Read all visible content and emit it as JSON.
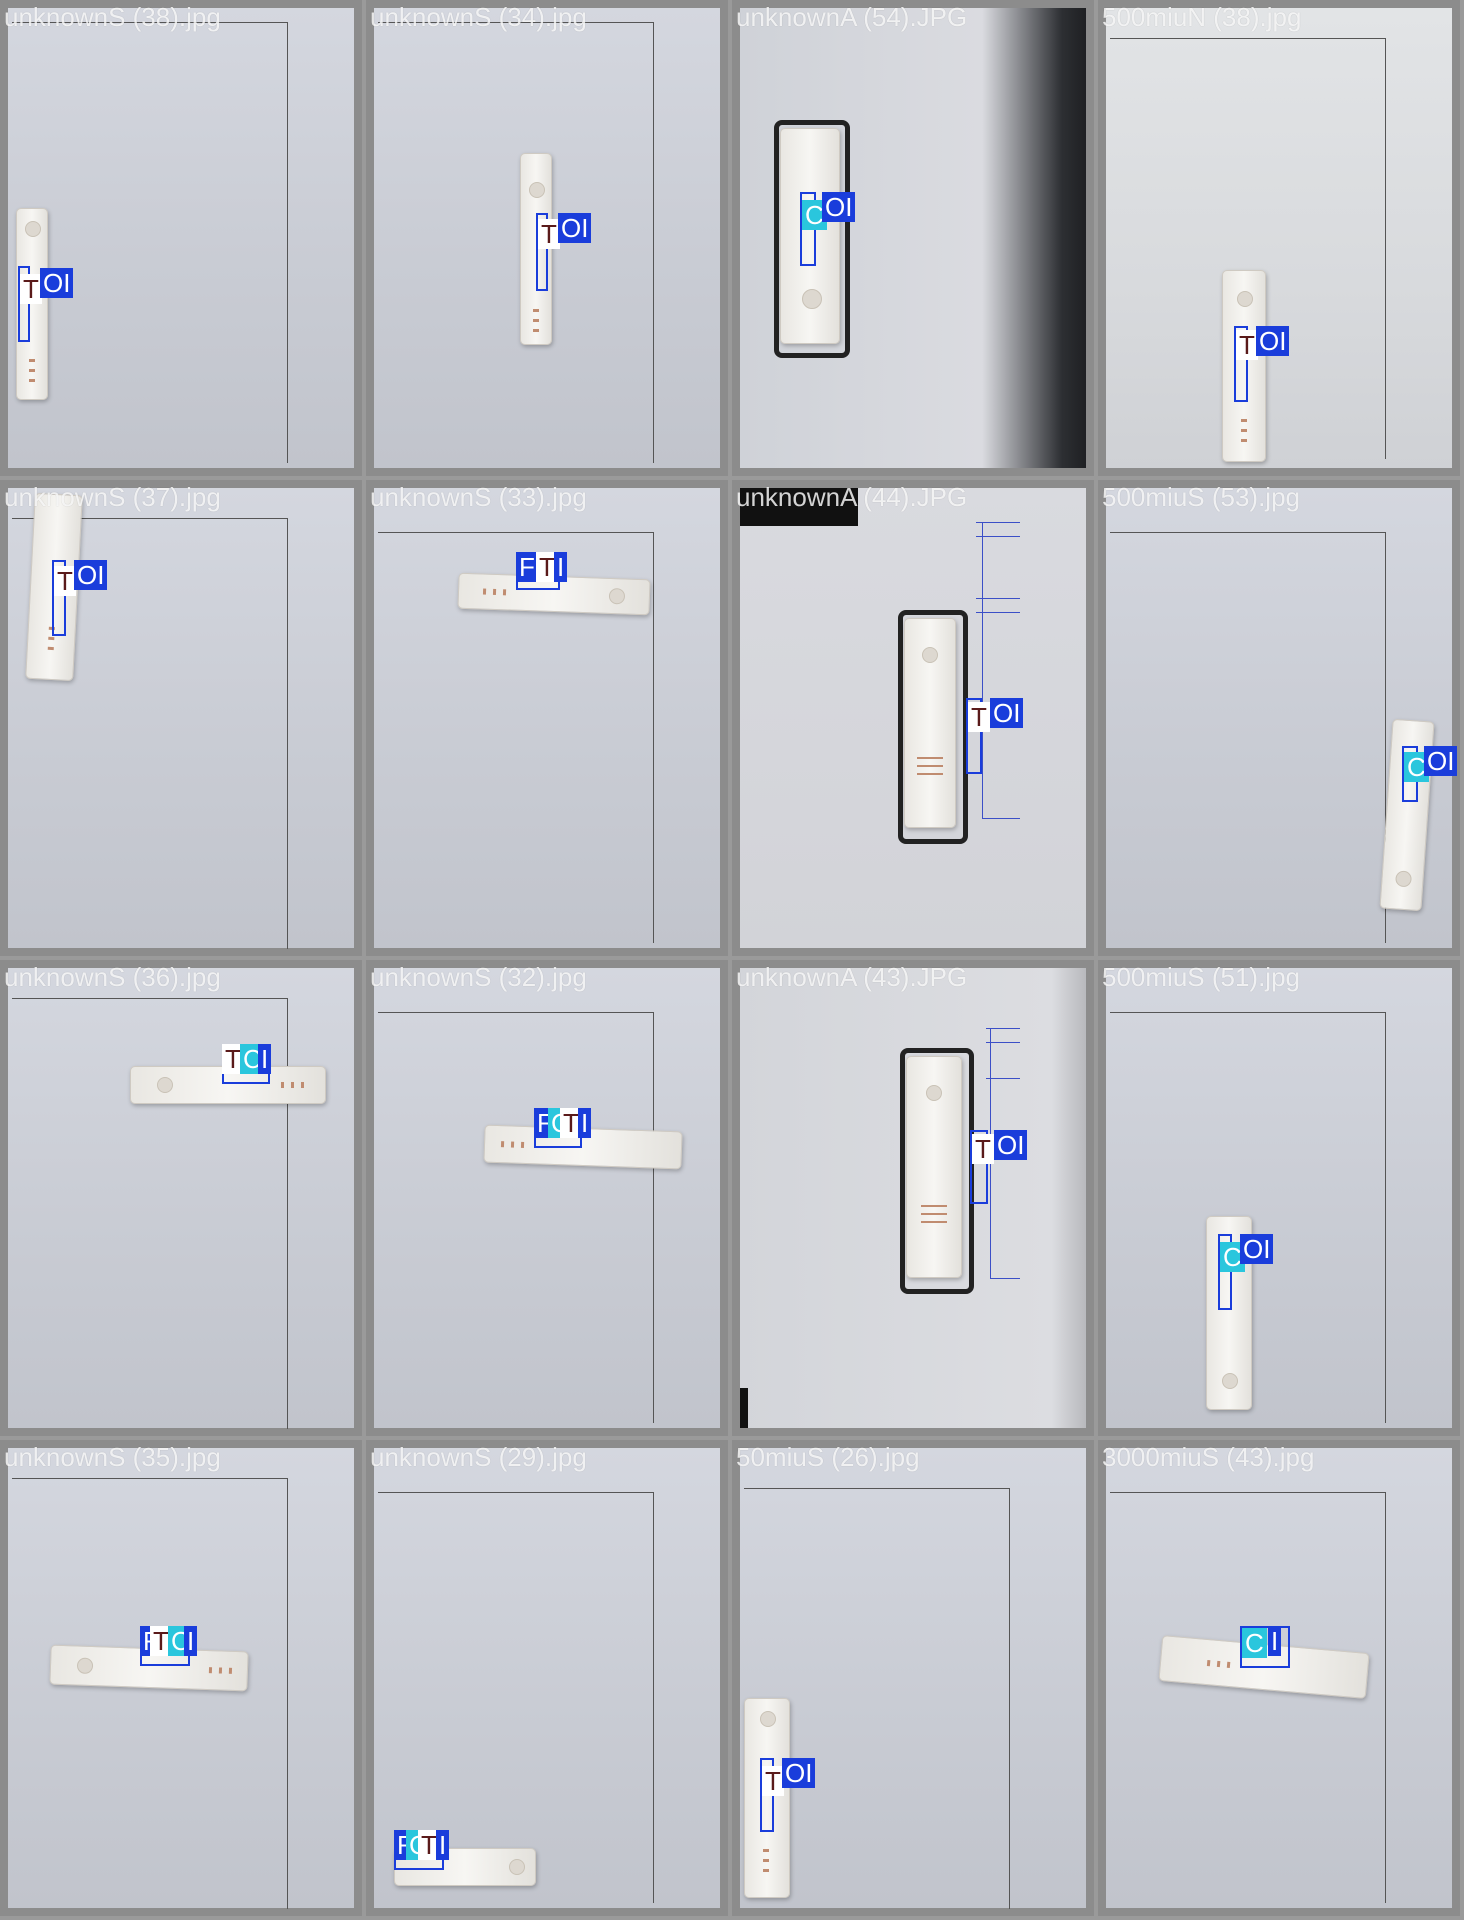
{
  "tiles": [
    {
      "filename": "unknownS (38).jpg"
    },
    {
      "filename": "unknownS (34).jpg"
    },
    {
      "filename": "unknownA (54).JPG"
    },
    {
      "filename": "500miuN (38).jpg"
    },
    {
      "filename": "unknownS (37).jpg"
    },
    {
      "filename": "unknownS (33).jpg"
    },
    {
      "filename": "unknownA (44).JPG"
    },
    {
      "filename": "500miuS (53).jpg"
    },
    {
      "filename": "unknownS (36).jpg"
    },
    {
      "filename": "unknownS (32).jpg"
    },
    {
      "filename": "unknownA (43).JPG"
    },
    {
      "filename": "500miuS (51).jpg"
    },
    {
      "filename": "unknownS (35).jpg"
    },
    {
      "filename": "unknownS (29).jpg"
    },
    {
      "filename": "50miuS (26).jpg"
    },
    {
      "filename": "3000miuS (43).jpg"
    }
  ],
  "labels": {
    "t": "T",
    "c": "C",
    "oi": "OI",
    "i": "I",
    "f": "F"
  },
  "colors": {
    "box_blue": "#1a3ddb",
    "box_cyan": "#2ac6dd",
    "t_brown": "#5a1a1a"
  }
}
